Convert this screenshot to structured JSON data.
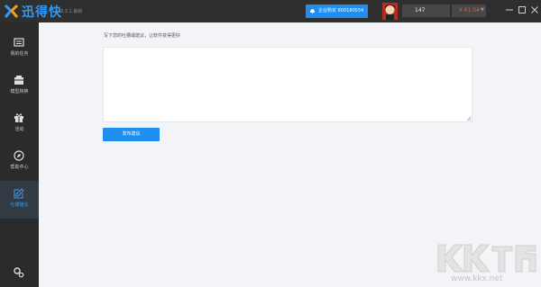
{
  "app": {
    "name": "迅得快",
    "version": "3.3.1 最新"
  },
  "header": {
    "enterprise_label": "企业购买 800180554",
    "user_id": "147",
    "balance": "¥ 61.04",
    "accent_color": "#1e8ff0"
  },
  "sidebar": {
    "items": [
      {
        "label": "我的任务",
        "icon": "task-icon"
      },
      {
        "label": "模型转换",
        "icon": "convert-icon"
      },
      {
        "label": "活动",
        "icon": "gift-icon"
      },
      {
        "label": "帮助中心",
        "icon": "compass-icon"
      },
      {
        "label": "吐槽建议",
        "icon": "edit-icon"
      }
    ],
    "active_index": 4,
    "settings_icon": "gear-icon"
  },
  "main": {
    "prompt": "写下您的吐槽或建议，让软件变得更好",
    "textarea_value": "",
    "submit_label": "发布建议"
  },
  "watermark": {
    "logo_text": "KK下载",
    "url": "www.kkx.net"
  }
}
